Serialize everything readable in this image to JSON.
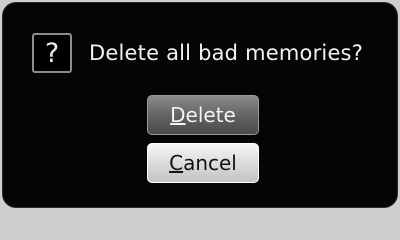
{
  "dialog": {
    "icon": "question-mark-icon",
    "icon_glyph": "?",
    "message": "Delete all bad memories?",
    "buttons": {
      "delete": {
        "mnemonic": "D",
        "rest": "elete"
      },
      "cancel": {
        "mnemonic": "C",
        "rest": "ancel"
      }
    }
  },
  "colors": {
    "dialog_background": "#050505",
    "text": "#f2f2f2",
    "delete_button": "#606060",
    "cancel_button": "#d9d9d9"
  }
}
